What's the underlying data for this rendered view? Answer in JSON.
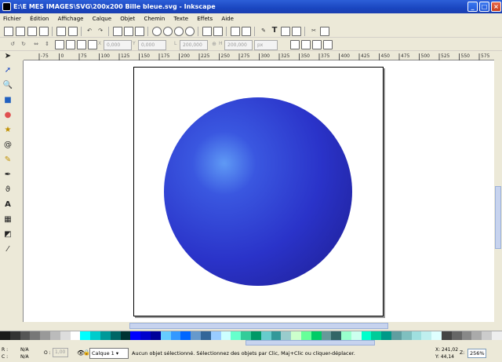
{
  "window": {
    "title": "E:\\E MES IMAGES\\SVG\\200x200 Bille bleue.svg - Inkscape"
  },
  "menu": [
    "Fichier",
    "Édition",
    "Affichage",
    "Calque",
    "Objet",
    "Chemin",
    "Texte",
    "Effets",
    "Aide"
  ],
  "controls": {
    "x_label": "X",
    "x_value": "0,000",
    "y_label": "Y",
    "y_value": "0,000",
    "w_label": "L",
    "w_value": "200,000",
    "h_label": "H",
    "h_value": "200,000",
    "unit": "px"
  },
  "ruler": {
    "ticks": [
      "-75",
      "0",
      "75",
      "100",
      "125",
      "150",
      "175",
      "200",
      "225",
      "250",
      "275",
      "300",
      "325",
      "350",
      "375",
      "400",
      "425",
      "450",
      "475",
      "500",
      "525",
      "550",
      "575"
    ]
  },
  "status": {
    "r_label": "R :",
    "r_value": "N/A",
    "c_label": "C :",
    "c_value": "N/A",
    "o_label": "O :",
    "o_value": "1,00",
    "layer": "Calque 1",
    "message": "Aucun objet sélectionné. Sélectionnez des objets par Clic, Maj+Clic ou cliquer-déplacer.",
    "x": "X: 241,02",
    "y": "Y: 44,14",
    "zoom": "256%"
  },
  "palette_colors": [
    "#1a1a1a",
    "#333",
    "#555",
    "#777",
    "#999",
    "#bbb",
    "#ddd",
    "#fff",
    "#00ffff",
    "#00cccc",
    "#009999",
    "#006666",
    "#003333",
    "#0000ff",
    "#0000cc",
    "#000099",
    "#66ccff",
    "#3399ff",
    "#0066ff",
    "#6699cc",
    "#336699",
    "#99ccff",
    "#ccffff",
    "#66ffcc",
    "#33cc99",
    "#009966",
    "#66cccc",
    "#339999",
    "#99cccc",
    "#ccffcc",
    "#66ff99",
    "#00cc66",
    "#669999",
    "#336666",
    "#99ffcc",
    "#ccffee",
    "#00ffcc",
    "#00cc99",
    "#009988",
    "#5f9ea0",
    "#7fbfbf",
    "#9fdfdf",
    "#bfefef",
    "#dfffff",
    "#444",
    "#666",
    "#888",
    "#aaa",
    "#ccc",
    "#eee"
  ]
}
